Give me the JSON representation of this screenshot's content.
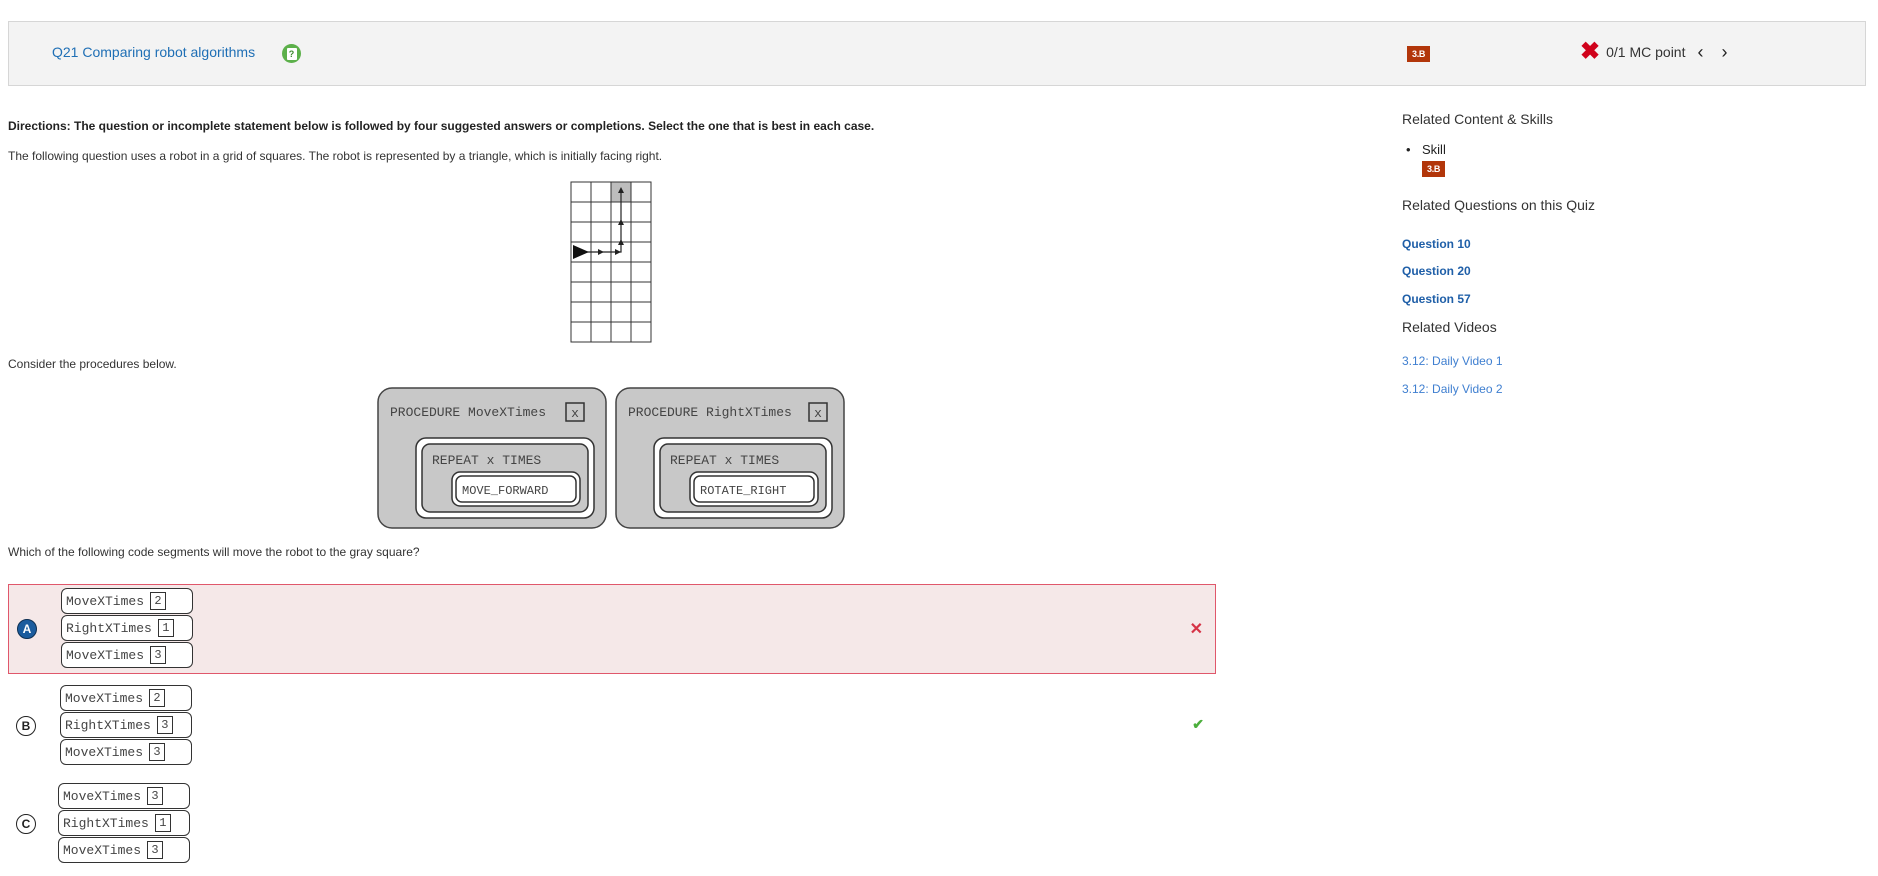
{
  "header": {
    "question_title": "Q21 Comparing robot algorithms",
    "question_icon": "question-note-icon",
    "skill_badge": "3.B",
    "score_icon": "x-mark-icon",
    "score_text": "0/1 MC point",
    "prev_icon": "chevron-left-icon",
    "next_icon": "chevron-right-icon",
    "prev_label": "‹",
    "next_label": "›"
  },
  "question": {
    "directions": "Directions: The question or incomplete statement below is followed by four suggested answers or completions. Select the one that is best in each case.",
    "intro": "The following question uses a robot in a grid of squares. The robot is represented by a triangle, which is initially facing right.",
    "grid": {
      "rows": 8,
      "cols": 4,
      "robot": {
        "row": 3,
        "col": 0,
        "facing": "right"
      },
      "target": {
        "row": 0,
        "col": 2
      },
      "path": [
        [
          3,
          0
        ],
        [
          3,
          2
        ],
        [
          0,
          2
        ]
      ]
    },
    "consider": "Consider the procedures below.",
    "procedures": [
      {
        "header": "PROCEDURE MoveXTimes",
        "param": "x",
        "loop": "REPEAT x TIMES",
        "body": "MOVE_FORWARD"
      },
      {
        "header": "PROCEDURE RightXTimes",
        "param": "x",
        "loop": "REPEAT x TIMES",
        "body": "ROTATE_RIGHT"
      }
    ],
    "prompt": "Which of the following code segments will move the robot to the gray square?"
  },
  "choices": [
    {
      "letter": "A",
      "selected": true,
      "status": "incorrect",
      "status_icon": "x-icon",
      "status_glyph": "✕",
      "blocks": [
        {
          "name": "MoveXTimes",
          "arg": "2"
        },
        {
          "name": "RightXTimes",
          "arg": "1"
        },
        {
          "name": "MoveXTimes",
          "arg": "3"
        }
      ]
    },
    {
      "letter": "B",
      "selected": false,
      "status": "correct",
      "status_icon": "check-icon",
      "status_glyph": "✔",
      "blocks": [
        {
          "name": "MoveXTimes",
          "arg": "2"
        },
        {
          "name": "RightXTimes",
          "arg": "3"
        },
        {
          "name": "MoveXTimes",
          "arg": "3"
        }
      ]
    },
    {
      "letter": "C",
      "selected": false,
      "status": "",
      "status_icon": "",
      "status_glyph": "",
      "blocks": [
        {
          "name": "MoveXTimes",
          "arg": "3"
        },
        {
          "name": "RightXTimes",
          "arg": "1"
        },
        {
          "name": "MoveXTimes",
          "arg": "3"
        }
      ]
    }
  ],
  "sidebar": {
    "related_content_heading": "Related Content & Skills",
    "skill_label": "Skill",
    "skill_badge": "3.B",
    "related_questions_heading": "Related Questions on this Quiz",
    "related_questions": [
      "Question 10",
      "Question 20",
      "Question 57"
    ],
    "related_videos_heading": "Related Videos",
    "related_videos": [
      "3.12: Daily Video 1",
      "3.12: Daily Video 2"
    ]
  },
  "colors": {
    "link_blue": "#1f6fb5",
    "badge_red": "#b2360a",
    "wrong_border": "#e0576b",
    "wrong_bg": "#f5e8e8",
    "correct_green": "#4caf3d",
    "selected_letter": "#1b5c9e"
  }
}
